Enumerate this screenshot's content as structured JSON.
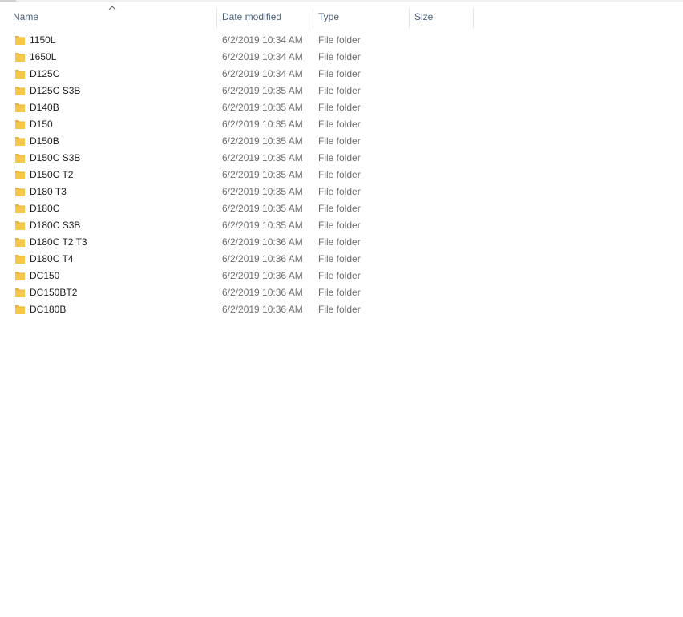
{
  "columns": {
    "name": "Name",
    "date_modified": "Date modified",
    "type": "Type",
    "size": "Size",
    "sort_icon": "chevron-up-icon"
  },
  "colors": {
    "header_text": "#4c607a",
    "name_text": "#1e1e1e",
    "meta_text": "#6d6d6d",
    "folder": "#f5c84c"
  },
  "files": [
    {
      "name": "1150L",
      "date": "6/2/2019 10:34 AM",
      "type": "File folder",
      "size": "",
      "icon": "folder-icon"
    },
    {
      "name": "1650L",
      "date": "6/2/2019 10:34 AM",
      "type": "File folder",
      "size": "",
      "icon": "folder-icon"
    },
    {
      "name": "D125C",
      "date": "6/2/2019 10:34 AM",
      "type": "File folder",
      "size": "",
      "icon": "folder-icon"
    },
    {
      "name": "D125C S3B",
      "date": "6/2/2019 10:35 AM",
      "type": "File folder",
      "size": "",
      "icon": "folder-icon"
    },
    {
      "name": "D140B",
      "date": "6/2/2019 10:35 AM",
      "type": "File folder",
      "size": "",
      "icon": "folder-icon"
    },
    {
      "name": "D150",
      "date": "6/2/2019 10:35 AM",
      "type": "File folder",
      "size": "",
      "icon": "folder-icon"
    },
    {
      "name": "D150B",
      "date": "6/2/2019 10:35 AM",
      "type": "File folder",
      "size": "",
      "icon": "folder-icon"
    },
    {
      "name": "D150C S3B",
      "date": "6/2/2019 10:35 AM",
      "type": "File folder",
      "size": "",
      "icon": "folder-icon"
    },
    {
      "name": "D150C T2",
      "date": "6/2/2019 10:35 AM",
      "type": "File folder",
      "size": "",
      "icon": "folder-icon"
    },
    {
      "name": "D180 T3",
      "date": "6/2/2019 10:35 AM",
      "type": "File folder",
      "size": "",
      "icon": "folder-icon"
    },
    {
      "name": "D180C",
      "date": "6/2/2019 10:35 AM",
      "type": "File folder",
      "size": "",
      "icon": "folder-icon"
    },
    {
      "name": "D180C S3B",
      "date": "6/2/2019 10:35 AM",
      "type": "File folder",
      "size": "",
      "icon": "folder-icon"
    },
    {
      "name": "D180C T2 T3",
      "date": "6/2/2019 10:36 AM",
      "type": "File folder",
      "size": "",
      "icon": "folder-icon"
    },
    {
      "name": "D180C T4",
      "date": "6/2/2019 10:36 AM",
      "type": "File folder",
      "size": "",
      "icon": "folder-icon"
    },
    {
      "name": "DC150",
      "date": "6/2/2019 10:36 AM",
      "type": "File folder",
      "size": "",
      "icon": "folder-icon"
    },
    {
      "name": "DC150BT2",
      "date": "6/2/2019 10:36 AM",
      "type": "File folder",
      "size": "",
      "icon": "folder-icon"
    },
    {
      "name": "DC180B",
      "date": "6/2/2019 10:36 AM",
      "type": "File folder",
      "size": "",
      "icon": "folder-icon"
    }
  ]
}
